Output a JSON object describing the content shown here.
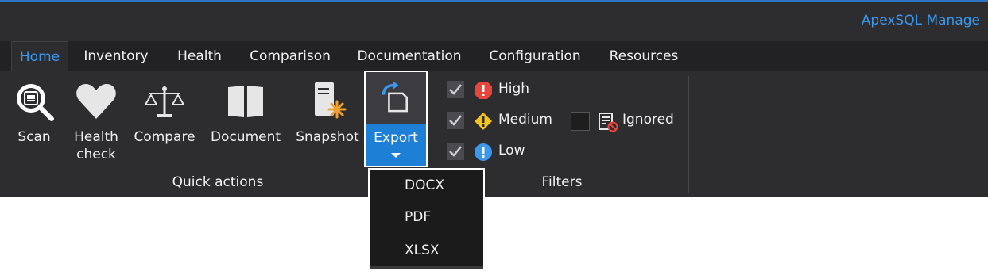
{
  "app": {
    "title": "ApexSQL Manage"
  },
  "tabs": [
    {
      "label": "Home",
      "active": true
    },
    {
      "label": "Inventory"
    },
    {
      "label": "Health"
    },
    {
      "label": "Comparison"
    },
    {
      "label": "Documentation"
    },
    {
      "label": "Configuration"
    },
    {
      "label": "Resources"
    }
  ],
  "quick_actions": {
    "group_label": "Quick actions",
    "buttons": [
      {
        "label": "Scan",
        "icon": "scan-magnifier-icon"
      },
      {
        "label": "Health check",
        "line1": "Health",
        "line2": "check",
        "icon": "heart-icon"
      },
      {
        "label": "Compare",
        "icon": "scales-icon"
      },
      {
        "label": "Document",
        "icon": "book-icon"
      },
      {
        "label": "Snapshot",
        "icon": "snapshot-icon"
      },
      {
        "label": "Export",
        "icon": "export-icon"
      }
    ]
  },
  "filters": {
    "group_label": "Filters",
    "items": [
      {
        "label": "High",
        "checked": true,
        "color": "#e8453c"
      },
      {
        "label": "Medium",
        "checked": true,
        "color": "#f5c518"
      },
      {
        "label": "Low",
        "checked": true,
        "color": "#3a98f0"
      },
      {
        "label": "Ignored",
        "checked": false
      }
    ]
  },
  "export_menu": {
    "items": [
      "DOCX",
      "PDF",
      "XLSX"
    ]
  },
  "colors": {
    "accent": "#3a98f0",
    "export_active": "#1e7fd6"
  }
}
